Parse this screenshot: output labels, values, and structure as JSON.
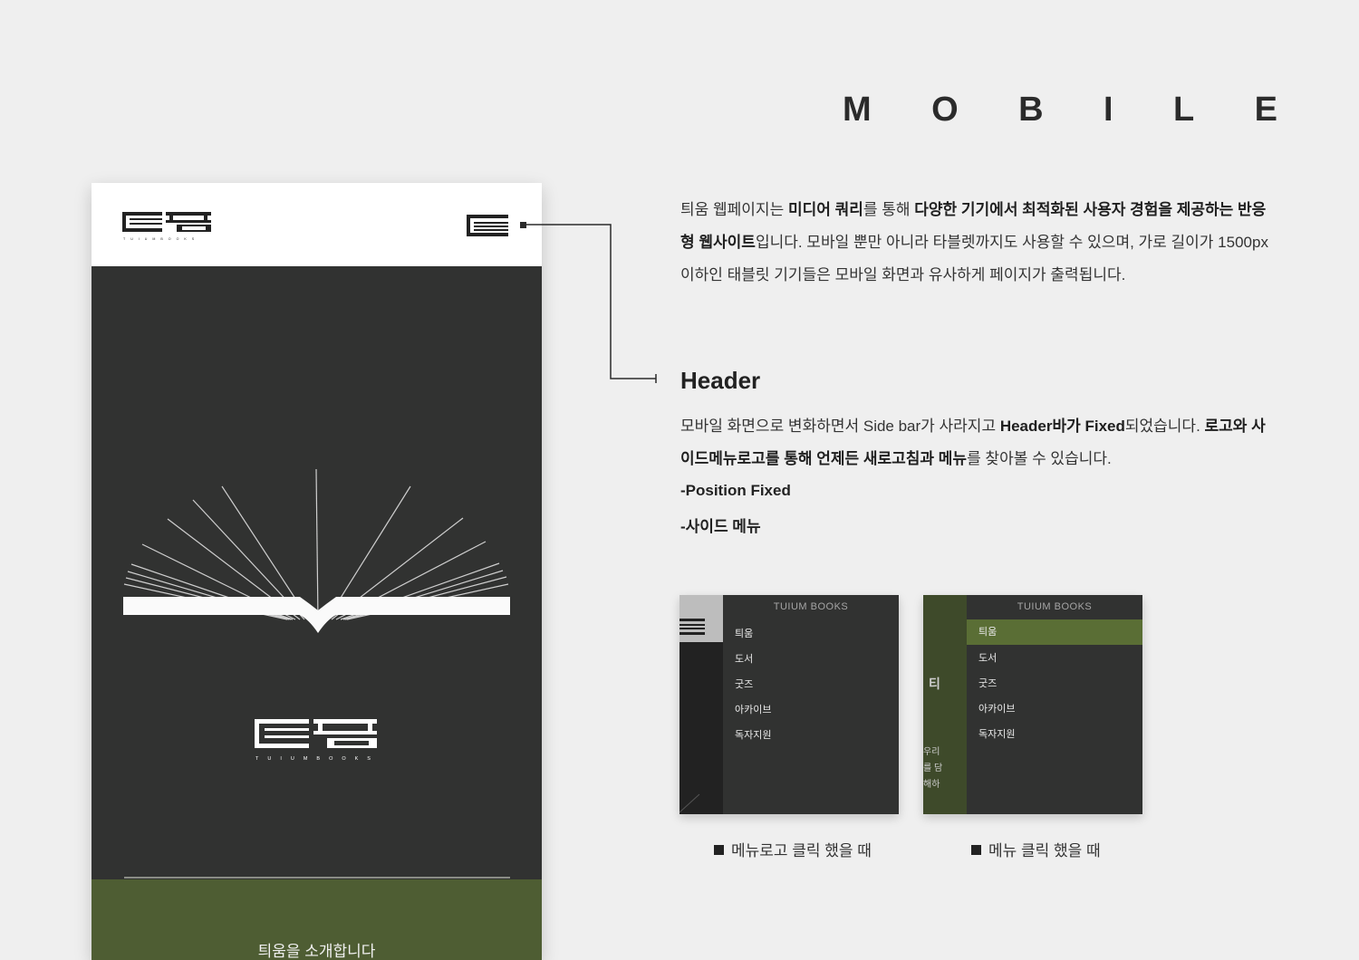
{
  "page_title_letters": [
    "M",
    "O",
    "B",
    "I",
    "L",
    "E"
  ],
  "phone": {
    "logo_caption": "TUIUMBOOKS",
    "intro_text": "틔움을 소개합니다"
  },
  "intro": {
    "p1": "틔움 웹페이지는 ",
    "b1": "미디어 쿼리",
    "p2": "를 통해 ",
    "b2": "다양한 기기에서 최적화된 사용자 경험을 제공하는 반응형 웹사이트",
    "p3": "입니다. 모바일 뿐만 아니라 타블렛까지도 사용할 수 있으며, 가로 길이가 1500px 이하인 태블릿 기기들은 모바일 화면과 유사하게 페이지가 출력됩니다."
  },
  "header_section": {
    "title": "Header",
    "p1": "모바일 화면으로 변화하면서 Side bar가 사라지고 ",
    "b1": "Header바가 Fixed",
    "p2": "되었습니다. ",
    "b2": "로고와 사이드메뉴로고를 통해 언제든 새로고침과 메뉴",
    "p3": "를 찾아볼 수 있습니다.",
    "bullets": [
      "-Position Fixed",
      "-사이드 메뉴"
    ]
  },
  "menu_panel": {
    "title": "TUIUM BOOKS",
    "items": [
      "틔움",
      "도서",
      "굿즈",
      "아카이브",
      "독자지원"
    ]
  },
  "screenshot_2_peek": [
    "티",
    "우리",
    "를 담",
    "해하"
  ],
  "captions": [
    "메뉴로고 클릭 했을 때",
    "메뉴 클릭 했을 때"
  ],
  "colors": {
    "background": "#efefef",
    "phone_dark": "#313231",
    "green": "#4e5d33",
    "active_menu": "#5a6e35"
  }
}
